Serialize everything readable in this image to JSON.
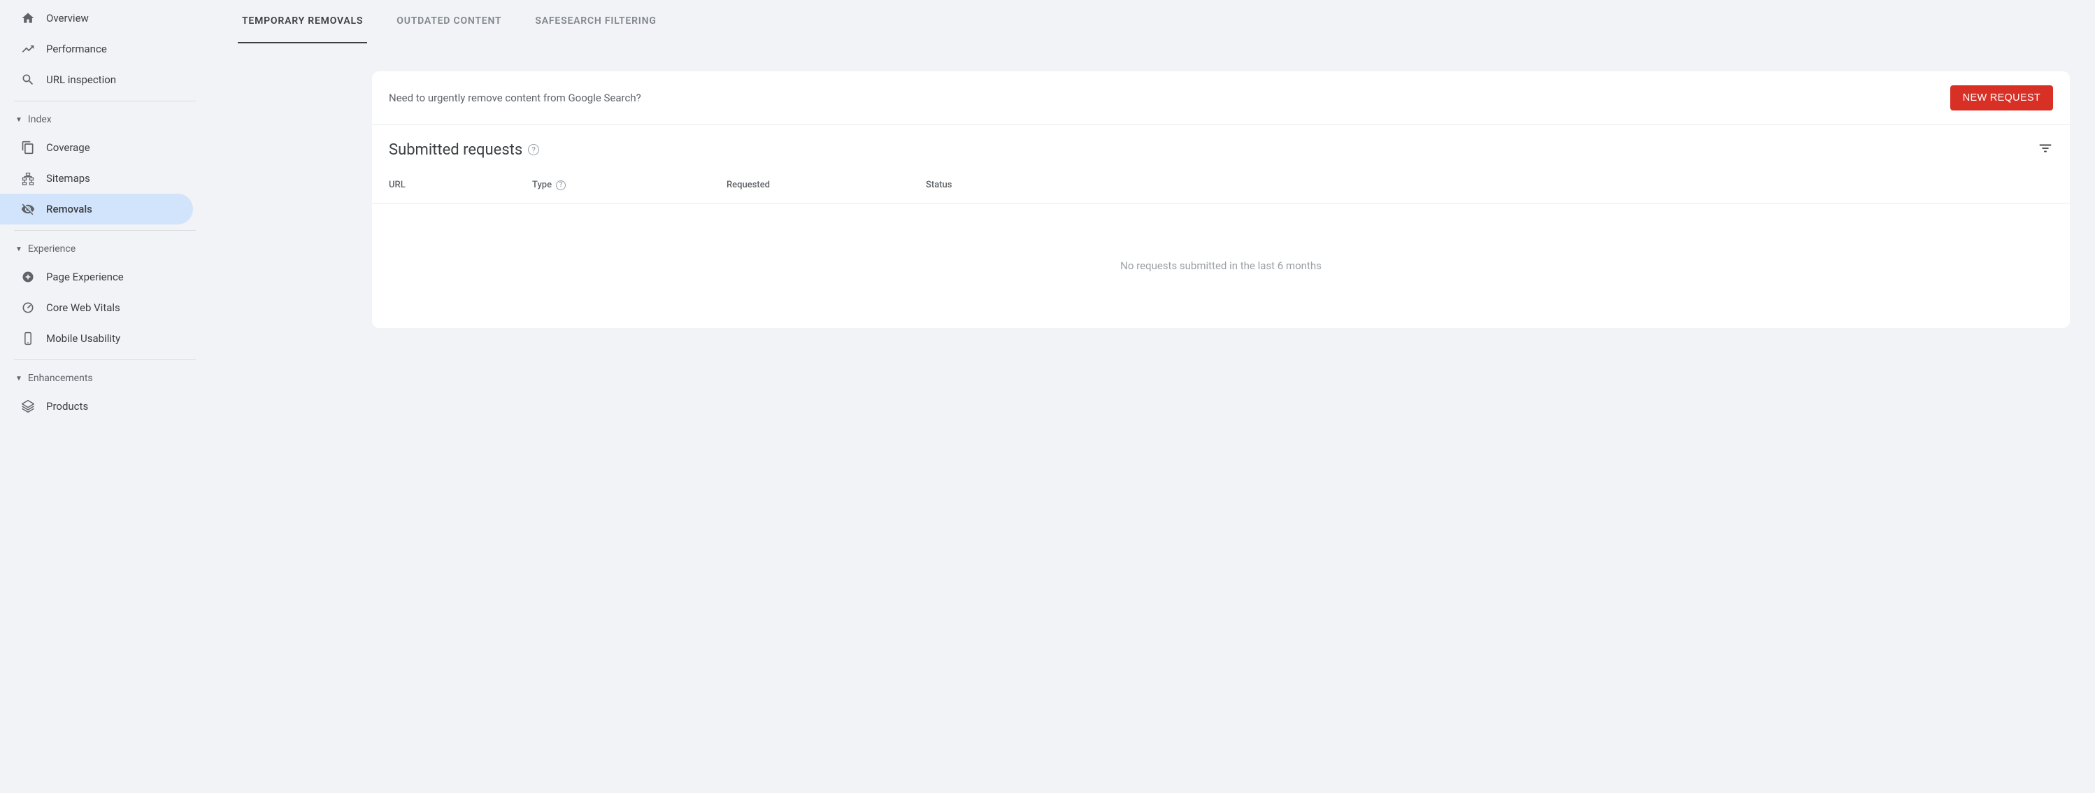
{
  "sidebar": {
    "items_top": [
      {
        "key": "overview",
        "label": "Overview",
        "icon": "home"
      },
      {
        "key": "performance",
        "label": "Performance",
        "icon": "trend"
      },
      {
        "key": "url-inspection",
        "label": "URL inspection",
        "icon": "search"
      }
    ],
    "sections": [
      {
        "key": "index",
        "label": "Index",
        "items": [
          {
            "key": "coverage",
            "label": "Coverage",
            "icon": "copy"
          },
          {
            "key": "sitemaps",
            "label": "Sitemaps",
            "icon": "sitemap"
          },
          {
            "key": "removals",
            "label": "Removals",
            "icon": "eyeoff",
            "active": true
          }
        ]
      },
      {
        "key": "experience",
        "label": "Experience",
        "items": [
          {
            "key": "page-experience",
            "label": "Page Experience",
            "icon": "circleplus"
          },
          {
            "key": "core-web-vitals",
            "label": "Core Web Vitals",
            "icon": "gauge"
          },
          {
            "key": "mobile-usability",
            "label": "Mobile Usability",
            "icon": "phone"
          }
        ]
      },
      {
        "key": "enhancements",
        "label": "Enhancements",
        "items": [
          {
            "key": "products",
            "label": "Products",
            "icon": "layers"
          }
        ]
      }
    ]
  },
  "tabs": [
    {
      "key": "temporary-removals",
      "label": "Temporary Removals",
      "active": true
    },
    {
      "key": "outdated-content",
      "label": "Outdated Content"
    },
    {
      "key": "safesearch-filtering",
      "label": "SafeSearch filtering"
    }
  ],
  "banner": {
    "text": "Need to urgently remove content from Google Search?",
    "button": "NEW REQUEST"
  },
  "section": {
    "title": "Submitted requests"
  },
  "table": {
    "headers": {
      "url": "URL",
      "type": "Type",
      "requested": "Requested",
      "status": "Status"
    },
    "empty": "No requests submitted in the last 6 months"
  }
}
